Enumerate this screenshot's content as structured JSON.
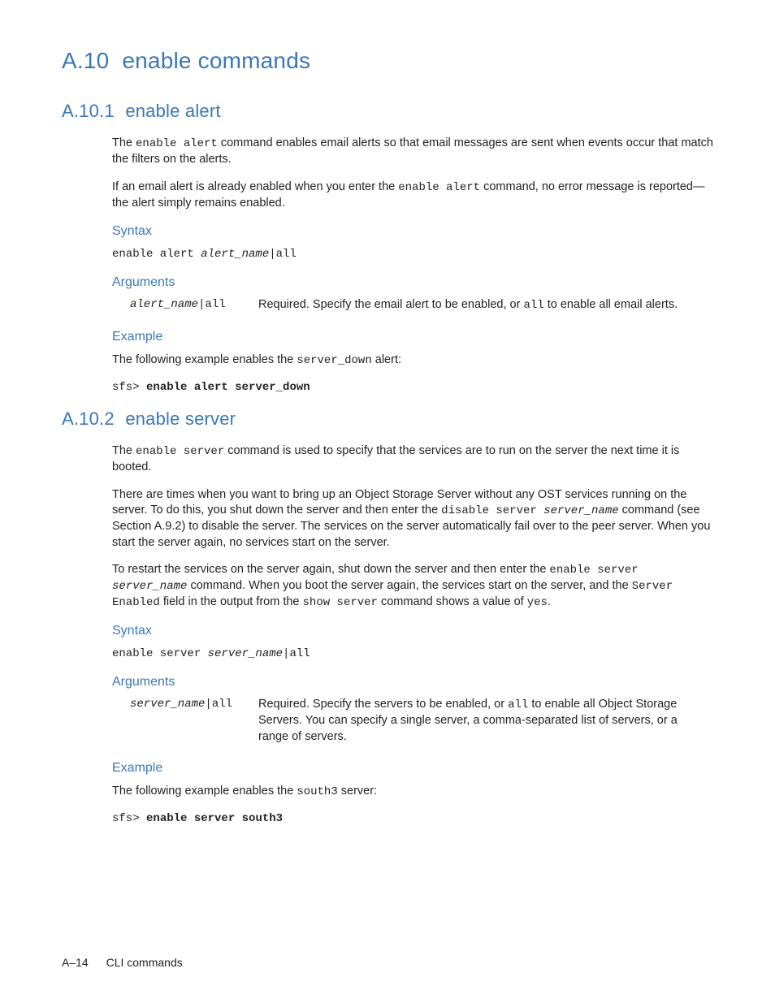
{
  "h1": {
    "num": "A.10",
    "title": "enable commands"
  },
  "sec1": {
    "num": "A.10.1",
    "title": "enable alert",
    "p1_a": "The ",
    "p1_code": "enable alert",
    "p1_b": " command enables email alerts so that email messages are sent when events occur that match the filters on the alerts.",
    "p2_a": "If an email alert is already enabled when you enter the ",
    "p2_code": "enable alert",
    "p2_b": " command, no error message is reported—the alert simply remains enabled.",
    "syntax_label": "Syntax",
    "syntax_a": "enable alert ",
    "syntax_var": "alert_name",
    "syntax_b": "|all",
    "args_label": "Arguments",
    "arg_name_var": "alert_name",
    "arg_name_rest": "|all",
    "arg_desc_a": "Required. Specify the email alert to be enabled, or ",
    "arg_desc_code": "all",
    "arg_desc_b": " to enable all email alerts.",
    "example_label": "Example",
    "ex_p_a": "The following example enables the ",
    "ex_p_code": "server_down",
    "ex_p_b": " alert:",
    "ex_prompt": "sfs> ",
    "ex_cmd": "enable alert server_down"
  },
  "sec2": {
    "num": "A.10.2",
    "title": "enable server",
    "p1_a": "The ",
    "p1_code": "enable server",
    "p1_b": " command is used to specify that the services are to run on the server the next time it is booted.",
    "p2_a": "There are times when you want to bring up an Object Storage Server without any OST services running on the server. To do this, you shut down the server and then enter the ",
    "p2_code": "disable server ",
    "p2_var": "server_name",
    "p2_b": " command (see Section A.9.2) to disable the server. The services on the server automatically fail over to the peer server. When you start the server again, no services start on the server.",
    "p3_a": "To restart the services on the server again, shut down the server and then enter the ",
    "p3_code1": "enable server ",
    "p3_var": "server_name",
    "p3_b": " command. When you boot the server again, the services start on the server, and the ",
    "p3_code2": "Server Enabled",
    "p3_c": " field in the output from the ",
    "p3_code3": "show server",
    "p3_d": " command shows a value of ",
    "p3_code4": "yes",
    "p3_e": ".",
    "syntax_label": "Syntax",
    "syntax_a": "enable server ",
    "syntax_var": "server_name",
    "syntax_b": "|all",
    "args_label": "Arguments",
    "arg_name_var": "server_name",
    "arg_name_rest": "|all",
    "arg_desc_a": "Required. Specify the servers to be enabled, or ",
    "arg_desc_code": "all",
    "arg_desc_b": " to enable all Object Storage Servers. You can specify a single server, a comma-separated list of servers, or a range of servers.",
    "example_label": "Example",
    "ex_p_a": "The following example enables the ",
    "ex_p_code": "south3",
    "ex_p_b": " server:",
    "ex_prompt": "sfs> ",
    "ex_cmd": "enable server south3"
  },
  "footer": {
    "page": "A–14",
    "title": "CLI commands"
  }
}
